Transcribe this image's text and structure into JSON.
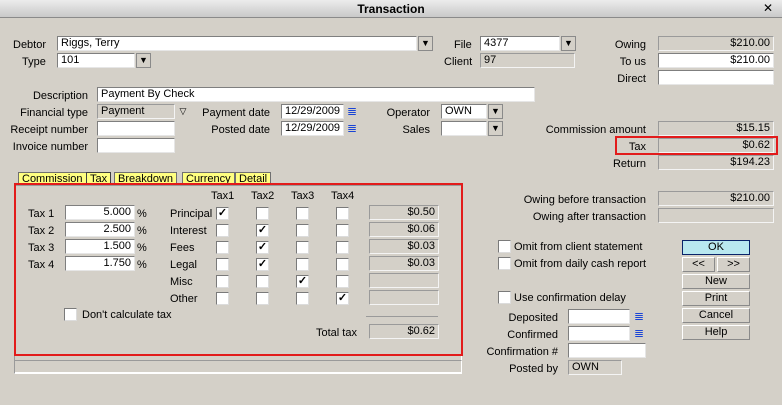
{
  "window": {
    "title": "Transaction"
  },
  "header": {
    "debtor": {
      "label": "Debtor",
      "value": "Riggs, Terry"
    },
    "type": {
      "label": "Type",
      "value": "101"
    },
    "file": {
      "label": "File",
      "value": "4377"
    },
    "client": {
      "label": "Client",
      "value": "97"
    },
    "owing": {
      "label": "Owing",
      "value": "$210.00"
    },
    "to_us": {
      "label": "To us",
      "value": "$210.00"
    },
    "direct": {
      "label": "Direct",
      "value": ""
    },
    "description": {
      "label": "Description",
      "value": "Payment By Check"
    },
    "financial_type": {
      "label": "Financial type",
      "value": "Payment"
    },
    "payment_date": {
      "label": "Payment date",
      "value": "12/29/2009"
    },
    "posted_date": {
      "label": "Posted date",
      "value": "12/29/2009"
    },
    "operator": {
      "label": "Operator",
      "value": "OWN"
    },
    "sales": {
      "label": "Sales",
      "value": ""
    },
    "receipt_number": {
      "label": "Receipt number",
      "value": ""
    },
    "invoice_number": {
      "label": "Invoice number",
      "value": ""
    },
    "commission_amount": {
      "label": "Commission amount",
      "value": "$15.15"
    },
    "tax": {
      "label": "Tax",
      "value": "$0.62"
    },
    "return": {
      "label": "Return",
      "value": "$194.23"
    }
  },
  "tabs": [
    {
      "label": "Commission"
    },
    {
      "label": "Tax"
    },
    {
      "label": "Breakdown"
    },
    {
      "label": "Currency"
    },
    {
      "label": "Detail"
    }
  ],
  "tax_panel": {
    "rates": [
      {
        "label": "Tax 1",
        "value": "5.000",
        "unit": "%"
      },
      {
        "label": "Tax 2",
        "value": "2.500",
        "unit": "%"
      },
      {
        "label": "Tax 3",
        "value": "1.500",
        "unit": "%"
      },
      {
        "label": "Tax 4",
        "value": "1.750",
        "unit": "%"
      }
    ],
    "columns": [
      "Tax1",
      "Tax2",
      "Tax3",
      "Tax4"
    ],
    "rows": [
      {
        "label": "Principal",
        "checks": [
          true,
          false,
          false,
          false
        ],
        "amount": "$0.50"
      },
      {
        "label": "Interest",
        "checks": [
          false,
          true,
          false,
          false
        ],
        "amount": "$0.06"
      },
      {
        "label": "Fees",
        "checks": [
          false,
          true,
          false,
          false
        ],
        "amount": "$0.03"
      },
      {
        "label": "Legal",
        "checks": [
          false,
          true,
          false,
          false
        ],
        "amount": "$0.03"
      },
      {
        "label": "Misc",
        "checks": [
          false,
          false,
          true,
          false
        ],
        "amount": ""
      },
      {
        "label": "Other",
        "checks": [
          false,
          false,
          false,
          true
        ],
        "amount": ""
      }
    ],
    "dont_calc_label": "Don't calculate tax",
    "total_label": "Total tax",
    "total_value": "$0.62"
  },
  "right_panel": {
    "owing_before": {
      "label": "Owing before transaction",
      "value": "$210.00"
    },
    "owing_after": {
      "label": "Owing after transaction",
      "value": ""
    },
    "omit_client": "Omit from client statement",
    "omit_daily": "Omit from daily cash report",
    "use_confirmation": "Use confirmation delay",
    "deposited": {
      "label": "Deposited",
      "value": ""
    },
    "confirmed": {
      "label": "Confirmed",
      "value": ""
    },
    "confirmation_num": {
      "label": "Confirmation #",
      "value": ""
    },
    "posted_by": {
      "label": "Posted by",
      "value": "OWN"
    }
  },
  "buttons": {
    "ok": "OK",
    "prev": "<<",
    "next": ">>",
    "new": "New",
    "print": "Print",
    "cancel": "Cancel",
    "help": "Help"
  },
  "colors": {
    "highlight": "#e21b1b",
    "tab": "#ffff80",
    "default_button": "#b9e8f0"
  }
}
